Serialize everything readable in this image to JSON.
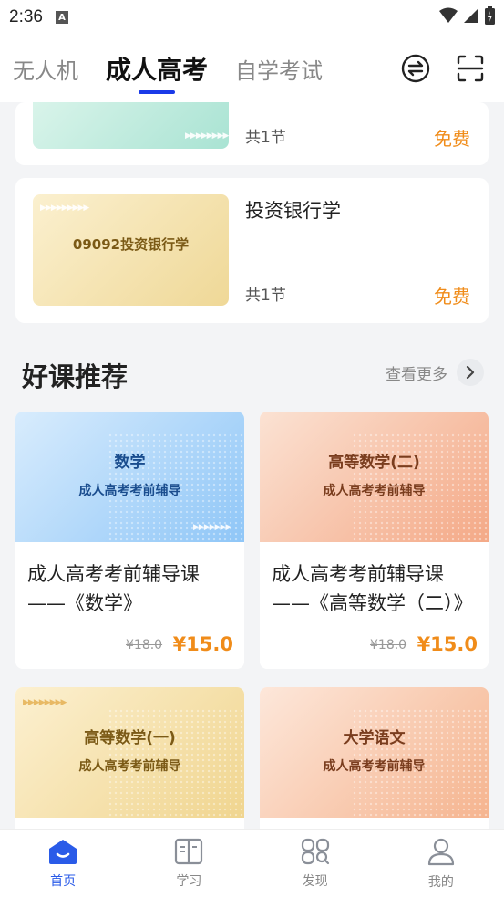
{
  "status_bar": {
    "time": "2:36"
  },
  "top_tabs": [
    {
      "label": "无人机"
    },
    {
      "label": "成人高考"
    },
    {
      "label": "自学考试"
    }
  ],
  "list_cards": [
    {
      "thumb_text": "",
      "title": "",
      "count": "共1节",
      "price": "免费"
    },
    {
      "thumb_text": "09092投资银行学",
      "title": "投资银行学",
      "count": "共1节",
      "price": "免费"
    }
  ],
  "section": {
    "title": "好课推荐",
    "more_label": "查看更多"
  },
  "courses": [
    {
      "thumb_title": "数学",
      "thumb_subtitle": "成人高考考前辅导",
      "title": "成人高考考前辅导课——《数学》",
      "old_price": "¥18.0",
      "price": "¥15.0"
    },
    {
      "thumb_title": "高等数学(二)",
      "thumb_subtitle": "成人高考考前辅导",
      "title": "成人高考考前辅导课——《高等数学（二）》",
      "old_price": "¥18.0",
      "price": "¥15.0"
    },
    {
      "thumb_title": "高等数学(一)",
      "thumb_subtitle": "成人高考考前辅导",
      "title": "",
      "old_price": "",
      "price": ""
    },
    {
      "thumb_title": "大学语文",
      "thumb_subtitle": "成人高考考前辅导",
      "title": "",
      "old_price": "",
      "price": ""
    }
  ],
  "bottom_nav": [
    {
      "label": "首页",
      "icon": "home-icon"
    },
    {
      "label": "学习",
      "icon": "book-icon"
    },
    {
      "label": "发现",
      "icon": "discover-icon"
    },
    {
      "label": "我的",
      "icon": "profile-icon"
    }
  ],
  "colors": {
    "accent": "#1a3ae8",
    "price": "#f08c1a",
    "active_nav": "#2a5be8"
  }
}
